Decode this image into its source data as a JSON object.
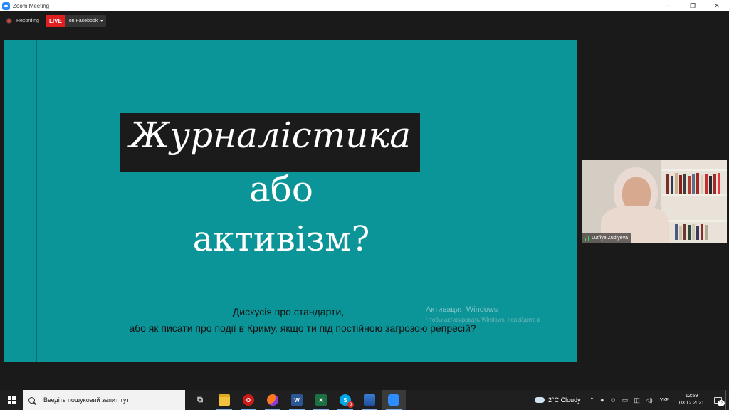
{
  "window": {
    "title": "Zoom Meeting",
    "app_icon": "zoom-icon",
    "controls": {
      "minimize": "─",
      "maximize": "❐",
      "close": "✕"
    }
  },
  "meeting": {
    "recording_label": "Recording",
    "live_badge": "LIVE",
    "live_destination": "on Facebook",
    "live_caret": "▾"
  },
  "slide": {
    "title_line1": "Журналістика",
    "title_line2": "або",
    "title_line3": "активізм?",
    "subtitle_line1": "Дискусія про стандарти,",
    "subtitle_line2": "або як писати про події в Криму, якщо ти під постійною загрозою репресій?",
    "watermark_line1": "Активация Windows",
    "watermark_line2": "Чтобы активировать Windows, перейдите в",
    "colors": {
      "background": "#0c9598",
      "title_box": "#1b1b1b"
    }
  },
  "participant": {
    "name": "Lutfiye Zudiyeva"
  },
  "taskbar": {
    "search_placeholder": "Введіть пошуковий запит тут",
    "apps": [
      {
        "name": "task-view-icon",
        "glyph": "⧉"
      },
      {
        "name": "file-explorer-icon",
        "glyph": ""
      },
      {
        "name": "opera-icon",
        "glyph": "O"
      },
      {
        "name": "firefox-icon",
        "glyph": ""
      },
      {
        "name": "word-icon",
        "glyph": "W"
      },
      {
        "name": "excel-icon",
        "glyph": "X"
      },
      {
        "name": "skype-icon",
        "glyph": "S",
        "badge": "3"
      },
      {
        "name": "photos-icon",
        "glyph": ""
      },
      {
        "name": "zoom-icon",
        "glyph": ""
      }
    ],
    "weather": "2°C  Cloudy",
    "tray_icons": [
      "chevron-up-icon",
      "microphone-icon",
      "people-icon",
      "battery-icon",
      "network-icon",
      "volume-icon"
    ],
    "language": "УКР",
    "time": "12:59",
    "date": "03.12.2021",
    "notifications_count": "13"
  }
}
